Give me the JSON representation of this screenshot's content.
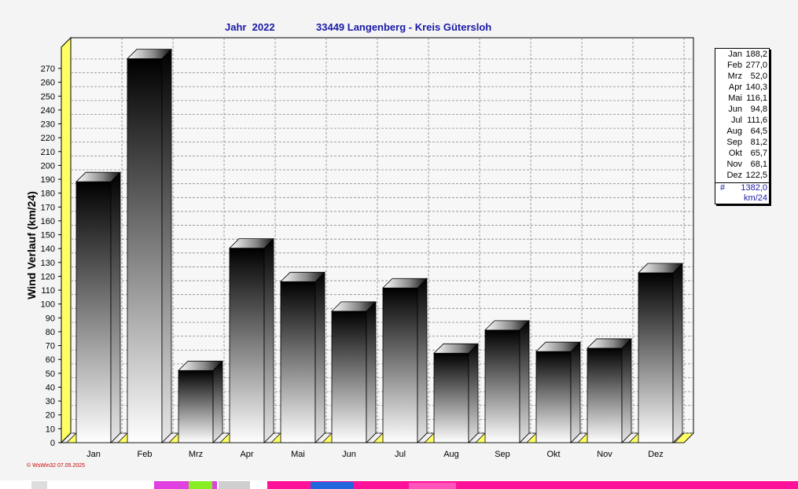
{
  "chart_data": {
    "type": "bar",
    "title": "Jahr  2022",
    "subtitle": "33449 Langenberg - Kreis Gütersloh",
    "ylabel": "Wind Verlauf  (km/24)",
    "xlabel": "",
    "categories": [
      "Jan",
      "Feb",
      "Mrz",
      "Apr",
      "Mai",
      "Jun",
      "Jul",
      "Aug",
      "Sep",
      "Okt",
      "Nov",
      "Dez"
    ],
    "values": [
      188.2,
      277.0,
      52.0,
      140.3,
      116.1,
      94.8,
      111.6,
      64.5,
      81.2,
      65.7,
      68.1,
      122.5
    ],
    "ylim": [
      0,
      270
    ],
    "ytick_step": 10,
    "grid": true,
    "legend_position": "right"
  },
  "legend": {
    "rows": [
      {
        "month": "Jan",
        "value": "188,2"
      },
      {
        "month": "Feb",
        "value": "277,0"
      },
      {
        "month": "Mrz",
        "value": "52,0"
      },
      {
        "month": "Apr",
        "value": "140,3"
      },
      {
        "month": "Mai",
        "value": "116,1"
      },
      {
        "month": "Jun",
        "value": "94,8"
      },
      {
        "month": "Jul",
        "value": "111,6"
      },
      {
        "month": "Aug",
        "value": "64,5"
      },
      {
        "month": "Sep",
        "value": "81,2"
      },
      {
        "month": "Okt",
        "value": "65,7"
      },
      {
        "month": "Nov",
        "value": "68,1"
      },
      {
        "month": "Dez",
        "value": "122,5"
      }
    ],
    "total_symbol": "#",
    "total": "1382,0",
    "unit": "km/24"
  },
  "credit": "© WsWin32  07.05.2025",
  "colors": {
    "title": "#1a1aa8",
    "floor": "#ffff66",
    "grid": "#888888",
    "bar_top": "#000000",
    "bar_bottom": "#ffffff",
    "credit": "#cc0000"
  }
}
